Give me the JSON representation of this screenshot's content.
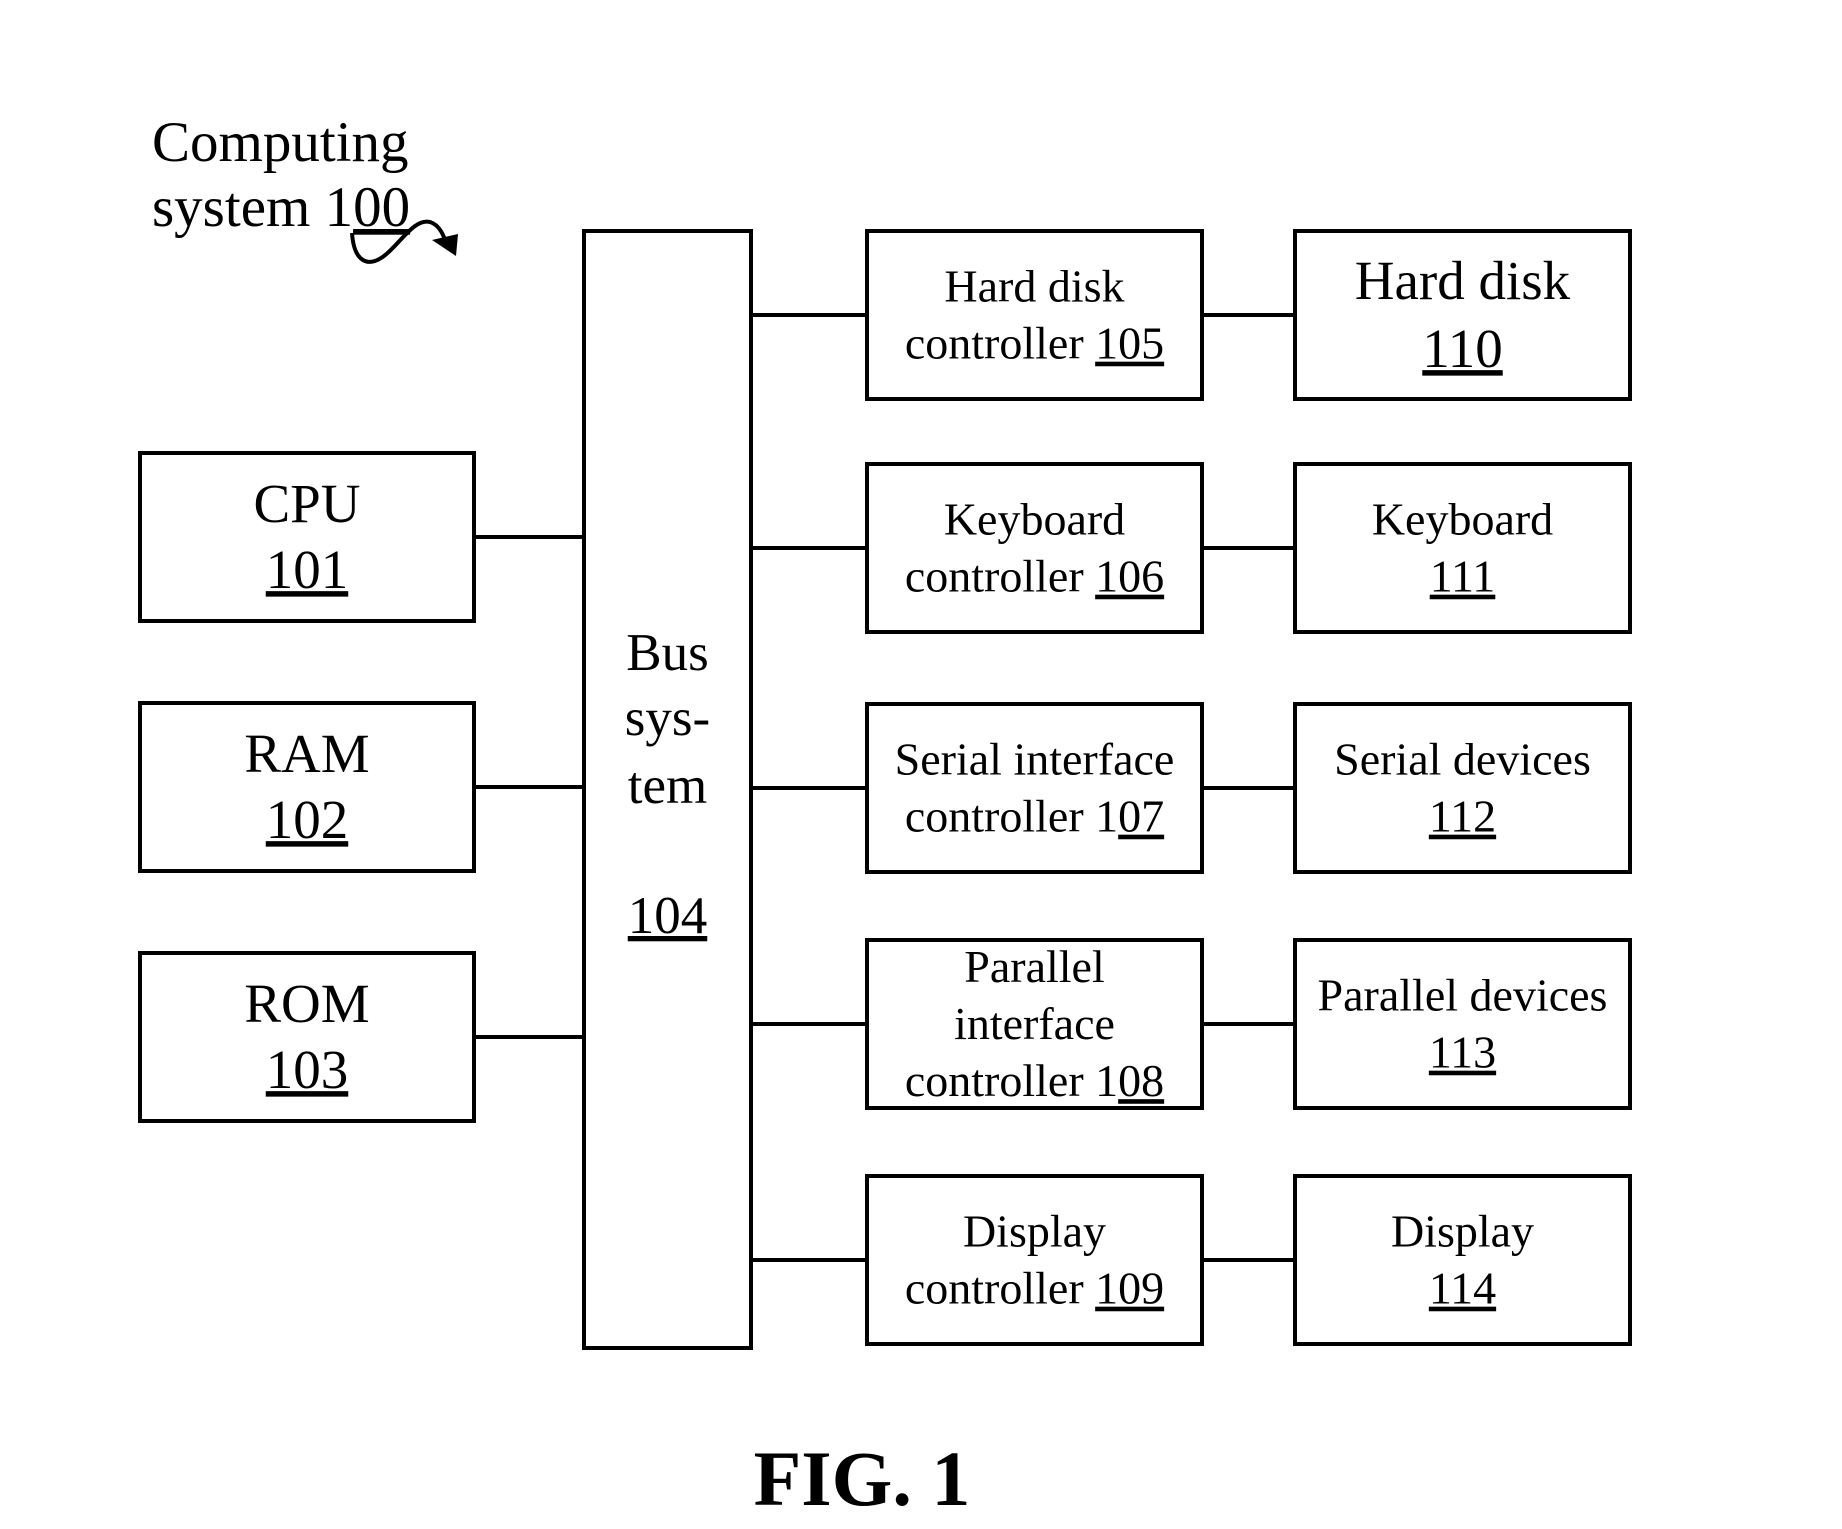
{
  "figure": {
    "caption": "FIG. 1",
    "system_label": {
      "line1": "Computing",
      "line2_text": "system 1",
      "line2_underlined": "00"
    }
  },
  "boxes": [
    {
      "id": "cpu",
      "name": "cpu-box",
      "lines": [
        "CPU"
      ],
      "ref_plain": "",
      "ref_underlined": "101",
      "ref_inline": false
    },
    {
      "id": "ram",
      "name": "ram-box",
      "lines": [
        "RAM"
      ],
      "ref_plain": "",
      "ref_underlined": "102",
      "ref_inline": false
    },
    {
      "id": "rom",
      "name": "rom-box",
      "lines": [
        "ROM"
      ],
      "ref_plain": "",
      "ref_underlined": "103",
      "ref_inline": false
    },
    {
      "id": "bus",
      "name": "bus-system-box",
      "lines": [
        "Bus",
        "sys-",
        "tem"
      ],
      "ref_plain": "",
      "ref_underlined": "104",
      "ref_inline": false
    },
    {
      "id": "hdc",
      "name": "hard-disk-controller-box",
      "lines": [
        "Hard disk",
        "controller "
      ],
      "ref_plain": "",
      "ref_underlined": "105",
      "ref_inline": true
    },
    {
      "id": "kbc",
      "name": "keyboard-controller-box",
      "lines": [
        "Keyboard",
        "controller "
      ],
      "ref_plain": "",
      "ref_underlined": "106",
      "ref_inline": true
    },
    {
      "id": "sic",
      "name": "serial-interface-controller-box",
      "lines": [
        "Serial interface",
        "controller "
      ],
      "ref_plain": "1",
      "ref_underlined": "07",
      "ref_inline": true
    },
    {
      "id": "pic",
      "name": "parallel-interface-controller-box",
      "lines": [
        "Parallel",
        "interface",
        "controller "
      ],
      "ref_plain": "1",
      "ref_underlined": "08",
      "ref_inline": true
    },
    {
      "id": "dc",
      "name": "display-controller-box",
      "lines": [
        "Display",
        "controller "
      ],
      "ref_plain": "",
      "ref_underlined": "109",
      "ref_inline": true
    },
    {
      "id": "hd",
      "name": "hard-disk-box",
      "lines": [
        "Hard disk"
      ],
      "ref_plain": "",
      "ref_underlined": "110",
      "ref_inline": false
    },
    {
      "id": "kb",
      "name": "keyboard-box",
      "lines": [
        "Keyboard"
      ],
      "ref_plain": "",
      "ref_underlined": "111",
      "ref_inline": false
    },
    {
      "id": "sd",
      "name": "serial-devices-box",
      "lines": [
        "Serial devices"
      ],
      "ref_plain": "",
      "ref_underlined": "112",
      "ref_inline": false
    },
    {
      "id": "pd",
      "name": "parallel-devices-box",
      "lines": [
        "Parallel devices"
      ],
      "ref_plain": "",
      "ref_underlined": "113",
      "ref_inline": false
    },
    {
      "id": "disp",
      "name": "display-box",
      "lines": [
        "Display"
      ],
      "ref_plain": "",
      "ref_underlined": "114",
      "ref_inline": false
    }
  ],
  "connections": [
    [
      "cpu",
      "bus"
    ],
    [
      "ram",
      "bus"
    ],
    [
      "rom",
      "bus"
    ],
    [
      "bus",
      "hdc"
    ],
    [
      "bus",
      "kbc"
    ],
    [
      "bus",
      "sic"
    ],
    [
      "bus",
      "pic"
    ],
    [
      "bus",
      "dc"
    ],
    [
      "hdc",
      "hd"
    ],
    [
      "kbc",
      "kb"
    ],
    [
      "sic",
      "sd"
    ],
    [
      "pic",
      "pd"
    ],
    [
      "dc",
      "disp"
    ]
  ]
}
